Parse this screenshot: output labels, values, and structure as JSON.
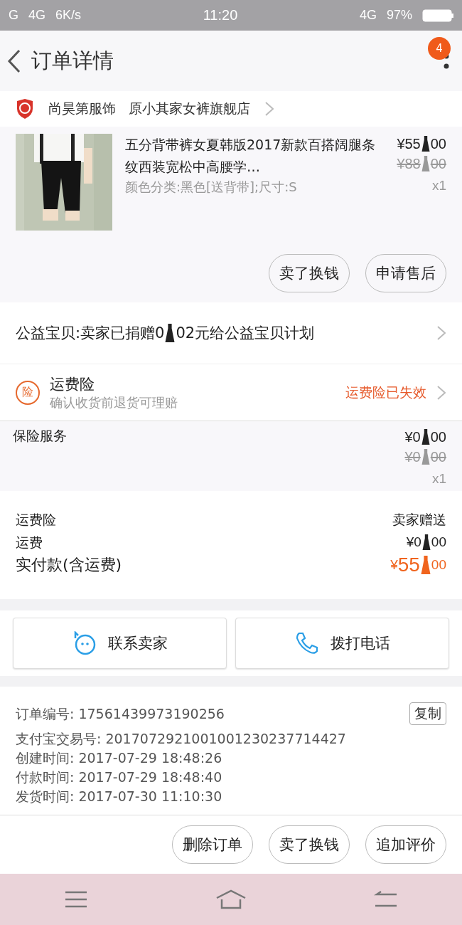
{
  "status_bar": {
    "left": [
      "G",
      "4G",
      "6K/s"
    ],
    "time": "11:20",
    "network": "4G",
    "battery": "97%"
  },
  "header": {
    "title": "订单详情",
    "badge": "4"
  },
  "shop": {
    "name": "尚昊第服饰",
    "store": "原小其家女裤旗舰店"
  },
  "product": {
    "kind": "picture",
    "title": "五分背带裤女夏韩版2017新款百搭阔腿条纹西装宽松中高腰学…",
    "sku": "颜色分类:黑色[送背带];尺寸:S",
    "price": {
      "int": "¥55",
      "dec": "00"
    },
    "old_price": {
      "int": "¥88",
      "dec": "00"
    },
    "qty": "x1"
  },
  "product_buttons": [
    "卖了换钱",
    "申请售后"
  ],
  "charity": {
    "before": "公益宝贝:卖家已捐赠0",
    "after": "02元给公益宝贝计划"
  },
  "insurance": {
    "badge": "险",
    "title": "运费险",
    "subtitle": "确认收货前退货可理赔",
    "status": "运费险已失效"
  },
  "service": {
    "label": "保险服务",
    "price": {
      "int": "¥0",
      "dec": "00"
    },
    "old_price": {
      "int": "¥0",
      "dec": "00"
    },
    "qty": "x1"
  },
  "summary": [
    {
      "label": "运费险",
      "value": "卖家赠送",
      "kind": "text"
    },
    {
      "label": "运费",
      "price": {
        "int": "¥0",
        "dec": "00"
      },
      "kind": "price"
    },
    {
      "label": "实付款(含运费)",
      "price": {
        "int": "¥55",
        "dec": "00"
      },
      "kind": "total"
    }
  ],
  "contact_buttons": [
    {
      "label": "联系卖家",
      "kind": "chat"
    },
    {
      "label": "拨打电话",
      "kind": "phone"
    }
  ],
  "order_info": {
    "copy_button": "复制",
    "rows": [
      "订单编号: 17561439973190256",
      "支付宝交易号: 2017072921001001230237714427",
      "创建时间: 2017-07-29  18:48:26",
      "付款时间: 2017-07-29  18:48:40",
      "发货时间: 2017-07-30  11:10:30"
    ]
  },
  "bottom_buttons": [
    "删除订单",
    "卖了换钱",
    "追加评价"
  ]
}
